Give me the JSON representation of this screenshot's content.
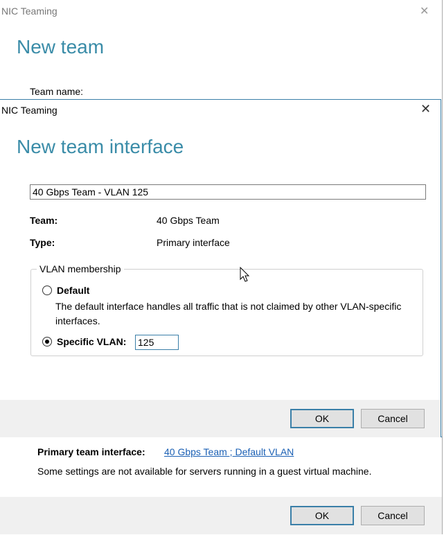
{
  "background_window": {
    "title": "NIC Teaming",
    "close_glyph": "✕",
    "heading": "New team",
    "team_name_label": "Team name:",
    "primary_team_interface_label": "Primary team interface:",
    "primary_team_interface_link": "40 Gbps Team ; Default VLAN",
    "guest_note": "Some settings are not available for servers running in a guest virtual machine.",
    "ok_label": "OK",
    "cancel_label": "Cancel"
  },
  "dialog": {
    "title": "NIC Teaming",
    "close_glyph": "✕",
    "heading": "New team interface",
    "interface_name_value": "40 Gbps Team  - VLAN 125",
    "team_label": "Team:",
    "team_value": "40 Gbps Team",
    "type_label": "Type:",
    "type_value": "Primary interface",
    "vlan_group": {
      "legend": "VLAN membership",
      "default_label": "Default",
      "default_description": "The default interface handles all traffic that is not claimed by other VLAN-specific interfaces.",
      "specific_label": "Specific VLAN:",
      "specific_value": "125",
      "selected": "specific"
    },
    "ok_label": "OK",
    "cancel_label": "Cancel"
  },
  "colors": {
    "heading": "#3a8ca8",
    "accent_border": "#3a7fa8",
    "link": "#1a5fb4",
    "button_bar": "#f0f0f0"
  },
  "icons": [
    "close-icon",
    "mouse-cursor-icon"
  ]
}
